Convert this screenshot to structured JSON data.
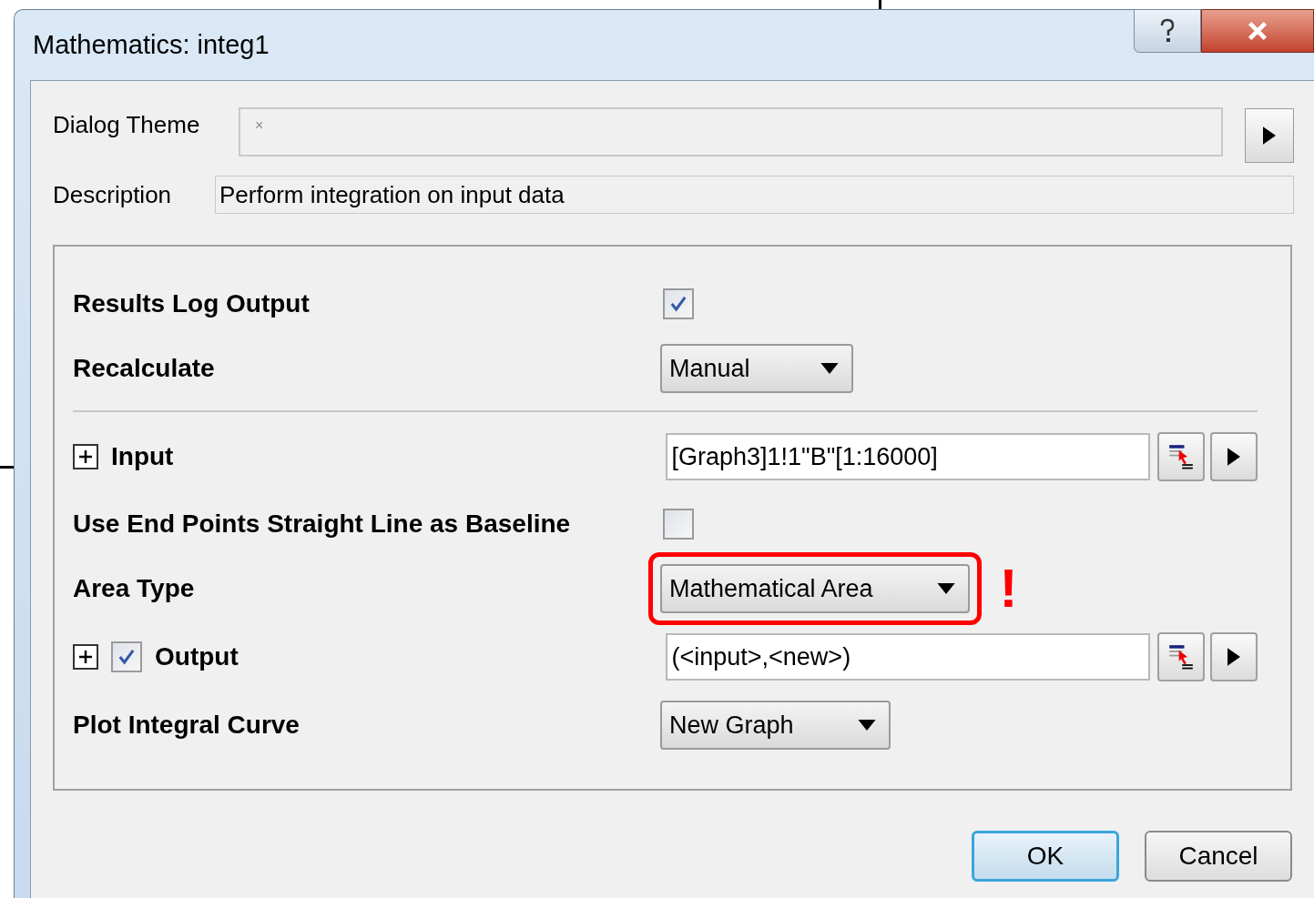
{
  "window": {
    "title": "Mathematics: integ1"
  },
  "dialog_theme": {
    "label": "Dialog Theme",
    "placeholder": "×"
  },
  "description": {
    "label": "Description",
    "value": "Perform integration on input data"
  },
  "rows": [
    {
      "kind": "checkbox",
      "label": "Results Log Output",
      "checked": true
    },
    {
      "kind": "dropdown",
      "label": "Recalculate",
      "value": "Manual",
      "highlighted": false
    },
    {
      "kind": "divider"
    },
    {
      "kind": "field",
      "label": "Input",
      "expanded": false,
      "value": "[Graph3]1!1\"B\"[1:16000]"
    },
    {
      "kind": "checkbox",
      "label": "Use End Points Straight Line as Baseline",
      "checked": false
    },
    {
      "kind": "dropdown",
      "label": "Area Type",
      "value": "Mathematical Area",
      "highlighted": true,
      "note": "!"
    },
    {
      "kind": "field",
      "label": "Output",
      "expanded": false,
      "checked": true,
      "value": "(<input>,<new>)"
    },
    {
      "kind": "dropdown",
      "label": "Plot Integral Curve",
      "value": "New Graph",
      "highlighted": false
    }
  ],
  "buttons": [
    {
      "label": "OK",
      "default": true
    },
    {
      "label": "Cancel",
      "default": false
    }
  ]
}
